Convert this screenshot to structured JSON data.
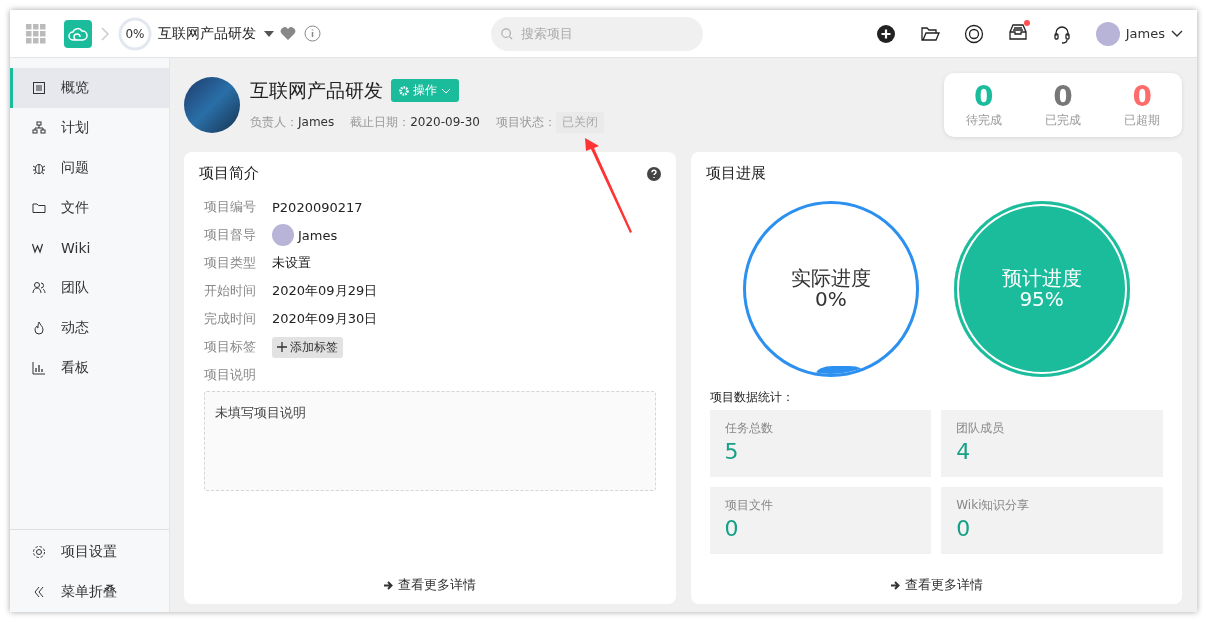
{
  "topbar": {
    "progress": {
      "label": "0%",
      "level": 0
    },
    "project_name": "互联网产品研发",
    "search": {
      "placeholder": "搜索项目"
    },
    "user": "James",
    "notification_dot": true
  },
  "sidebar": {
    "items": [
      {
        "kind": "overview",
        "label": "概览",
        "selected": true
      },
      {
        "kind": "plan",
        "label": "计划",
        "selected": false
      },
      {
        "kind": "issue",
        "label": "问题",
        "selected": false
      },
      {
        "kind": "file",
        "label": "文件",
        "selected": false
      },
      {
        "kind": "wiki",
        "label": "Wiki",
        "selected": false
      },
      {
        "kind": "team",
        "label": "团队",
        "selected": false
      },
      {
        "kind": "activity",
        "label": "动态",
        "selected": false
      },
      {
        "kind": "board",
        "label": "看板",
        "selected": false
      }
    ],
    "footer": [
      {
        "kind": "settings",
        "label": "项目设置"
      },
      {
        "kind": "collapse",
        "label": "菜单折叠"
      }
    ]
  },
  "project": {
    "title": "互联网产品研发",
    "action_button": "操作",
    "owner_label": "负责人：",
    "owner": "James",
    "deadline_label": "截止日期：",
    "deadline": "2020-09-30",
    "status_label": "项目状态：",
    "status": "已关闭"
  },
  "counters": [
    {
      "value": "0",
      "label": "待完成",
      "color": "#1abc9c"
    },
    {
      "value": "0",
      "label": "已完成",
      "color": "#777777"
    },
    {
      "value": "0",
      "label": "已超期",
      "color": "#ff6b6b"
    }
  ],
  "intro": {
    "title": "项目简介",
    "fields": [
      {
        "kind": "text",
        "label": "项目编号",
        "value": "P2020090217"
      },
      {
        "kind": "user",
        "label": "项目督导",
        "value": "James"
      },
      {
        "kind": "text",
        "label": "项目类型",
        "value": "未设置"
      },
      {
        "kind": "text",
        "label": "开始时间",
        "value": "2020年09月29日"
      },
      {
        "kind": "text",
        "label": "完成时间",
        "value": "2020年09月30日"
      },
      {
        "kind": "tag",
        "label": "项目标签",
        "value": "添加标签"
      },
      {
        "kind": "none",
        "label": "项目说明"
      }
    ],
    "description": "未填写项目说明",
    "more_link": "查看更多详情"
  },
  "progress": {
    "title": "项目进展",
    "gauges": [
      {
        "kind": "outline",
        "label": "实际进度",
        "value": "0%"
      },
      {
        "kind": "filled",
        "label": "预计进度",
        "value": "95%"
      }
    ],
    "stats_title": "项目数据统计：",
    "stats": [
      {
        "label": "任务总数",
        "value": "5"
      },
      {
        "label": "团队成员",
        "value": "4"
      },
      {
        "label": "项目文件",
        "value": "0"
      },
      {
        "label": "Wiki知识分享",
        "value": "0"
      }
    ],
    "more_link": "查看更多详情"
  },
  "annotation_arrow": true
}
